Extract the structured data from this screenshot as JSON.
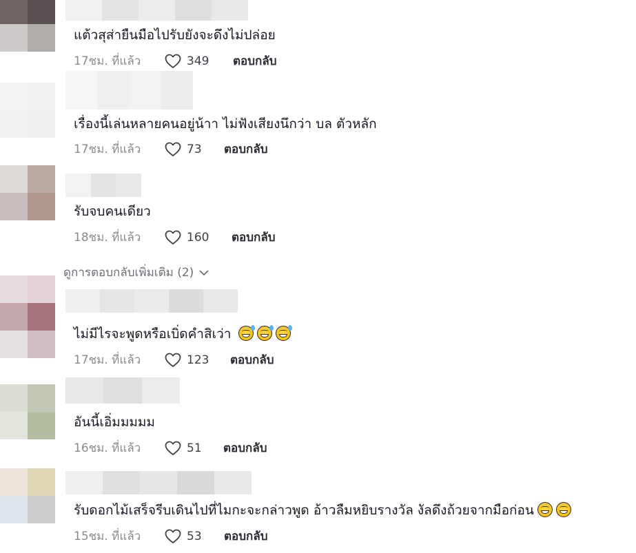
{
  "comments": [
    {
      "text": "แต้วสุส่ายืนมือไปรับยังจะดึงไม่ปล่อย",
      "time": "17ชม. ที่แล้ว",
      "likes": "349",
      "reply": "ตอบกลับ"
    },
    {
      "text": "เรื่องนี้เล่นหลายคนอยู่น้าา ไม่ฟังเสียงนึกว่า บล ตัวหลัก",
      "time": "17ชม. ที่แล้ว",
      "likes": "73",
      "reply": "ตอบกลับ"
    },
    {
      "text": "รับจบคนเดียว",
      "time": "18ชม. ที่แล้ว",
      "likes": "160",
      "reply": "ตอบกลับ"
    },
    {
      "text": "ไม่มีไรจะพูดหรือเบิ่ดคำสิเว่า",
      "time": "17ชม. ที่แล้ว",
      "likes": "123",
      "reply": "ตอบกลับ"
    },
    {
      "text": "อันนี้เอิ่มมมมม",
      "time": "16ชม. ที่แล้ว",
      "likes": "51",
      "reply": "ตอบกลับ"
    },
    {
      "text": "รับดอกไม้เสร็จรีบเดินไปที่ไมกะจะกล่าวพูด อ้าวลืมหยิบรางวัล งัลดึงถ้วยจากมือก่อน",
      "time": "15ชม. ที่แล้ว",
      "likes": "53",
      "reply": "ตอบกลับ"
    }
  ],
  "more_replies": "ดูการตอบกลับเพิ่มเติม (2)",
  "icons": {
    "like": "heart-outline-icon",
    "expand": "chevron-down-icon",
    "emoji_sweat": "grinning-sweat-emoji-icon",
    "emoji_tears": "tears-of-joy-emoji-icon"
  }
}
